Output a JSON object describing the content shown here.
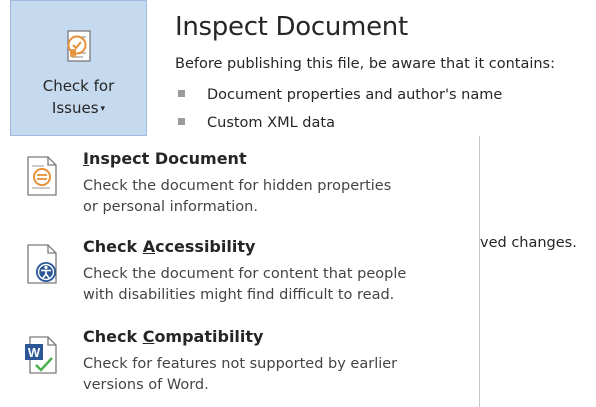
{
  "button": {
    "label_line1": "Check for",
    "label_line2": "Issues"
  },
  "info": {
    "title": "Inspect Document",
    "description": "Before publishing this file, be aware that it contains:",
    "bullets": [
      "Document properties and author's name",
      "Custom XML data"
    ],
    "partial_text": "ved changes."
  },
  "menu": {
    "items": [
      {
        "title_pre": "",
        "title_u": "I",
        "title_post": "nspect Document",
        "desc_line1": "Check the document for hidden properties",
        "desc_line2": "or personal information.",
        "icon": "inspect-document-icon"
      },
      {
        "title_pre": "Check ",
        "title_u": "A",
        "title_post": "ccessibility",
        "desc_line1": "Check the document for content that people",
        "desc_line2": "with disabilities might find difficult to read.",
        "icon": "accessibility-icon"
      },
      {
        "title_pre": "Check ",
        "title_u": "C",
        "title_post": "ompatibility",
        "desc_line1": "Check for features not supported by earlier",
        "desc_line2": "versions of Word.",
        "icon": "word-compatibility-icon"
      }
    ]
  },
  "colors": {
    "button_bg": "#c5d9ef",
    "accent_blue": "#2b5797",
    "icon_orange": "#e69138"
  }
}
